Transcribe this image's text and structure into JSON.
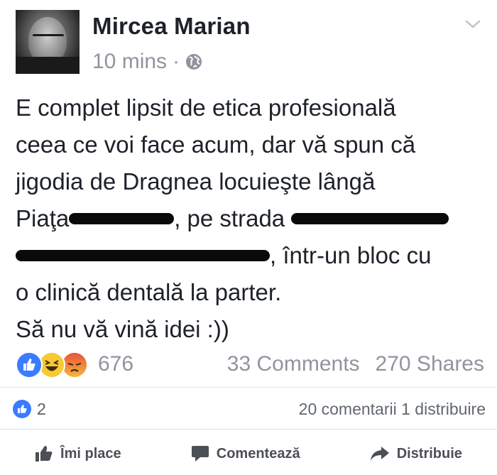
{
  "post": {
    "author": "Mircea Marian",
    "time": "10 mins",
    "separator": "·",
    "privacy_icon": "globe-icon",
    "menu_icon": "chevron-down-icon",
    "lines": [
      "E complet lipsit de etica profesională",
      "ceea ce voi face acum, dar vă spun că",
      "jigodia de Dragnea locuieşte lângă"
    ],
    "line4_start": "Piaţa",
    "line4_mid": ", pe strada",
    "line5_end": ", într-un bloc cu",
    "line6": "o clinică dentală la parter.",
    "line7": "Să nu vă vină idei :))"
  },
  "reactions": {
    "icons": [
      "like-icon",
      "haha-icon",
      "angry-icon"
    ],
    "count": "676",
    "comments": "33 Comments",
    "shares": "270 Shares"
  },
  "shared_bar": {
    "likes": "2",
    "summary": "20 comentarii 1 distribuire"
  },
  "actions": {
    "like": "Îmi place",
    "comment": "Comentează",
    "share": "Distribuie"
  },
  "colors": {
    "text": "#1d2129",
    "meta": "#90949c",
    "like_blue": "#3b7bff",
    "redaction": "#0a0a0a"
  }
}
